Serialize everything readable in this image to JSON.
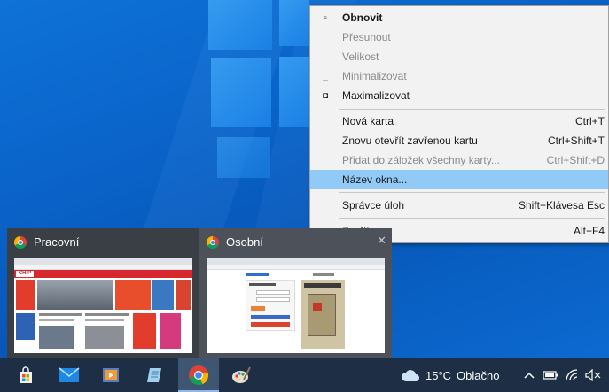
{
  "menu": {
    "items": [
      {
        "glyph": "▫",
        "label": "Obnovit",
        "shortcut": "",
        "state": "bold"
      },
      {
        "glyph": "",
        "label": "Přesunout",
        "shortcut": "",
        "state": "disabled"
      },
      {
        "glyph": "",
        "label": "Velikost",
        "shortcut": "",
        "state": "disabled"
      },
      {
        "glyph": "_",
        "label": "Minimalizovat",
        "shortcut": "",
        "state": "disabled"
      },
      {
        "glyph": "◘",
        "label": "Maximalizovat",
        "shortcut": "",
        "state": "normal"
      },
      {
        "glyph": "",
        "label": "Nová karta",
        "shortcut": "Ctrl+T",
        "state": "normal"
      },
      {
        "glyph": "",
        "label": "Znovu otevřít zavřenou kartu",
        "shortcut": "Ctrl+Shift+T",
        "state": "normal"
      },
      {
        "glyph": "",
        "label": "Přidat do záložek všechny karty...",
        "shortcut": "Ctrl+Shift+D",
        "state": "disabled"
      },
      {
        "glyph": "",
        "label": "Název okna...",
        "shortcut": "",
        "state": "highlighted"
      },
      {
        "glyph": "",
        "label": "Správce úloh",
        "shortcut": "Shift+Klávesa Esc",
        "state": "normal"
      },
      {
        "glyph": "x",
        "label": "Zavřít",
        "shortcut": "Alt+F4",
        "state": "normal"
      }
    ]
  },
  "thumbnails": [
    {
      "title": "Pracovní",
      "preview_logo": "CHIP"
    },
    {
      "title": "Osobní",
      "close_glyph": "✕"
    }
  ],
  "taskbar": {
    "apps": [
      {
        "name": "store-icon"
      },
      {
        "name": "mail-icon"
      },
      {
        "name": "video-editor-icon"
      },
      {
        "name": "notepad-icon"
      },
      {
        "name": "chrome-icon"
      },
      {
        "name": "paint-icon"
      }
    ],
    "weather": {
      "temperature": "15°C",
      "condition": "Oblačno"
    }
  },
  "colors": {
    "menu_highlight": "#91c9f7",
    "taskbar": "#1d2e45",
    "thumb_panel": "#3a3e45"
  }
}
